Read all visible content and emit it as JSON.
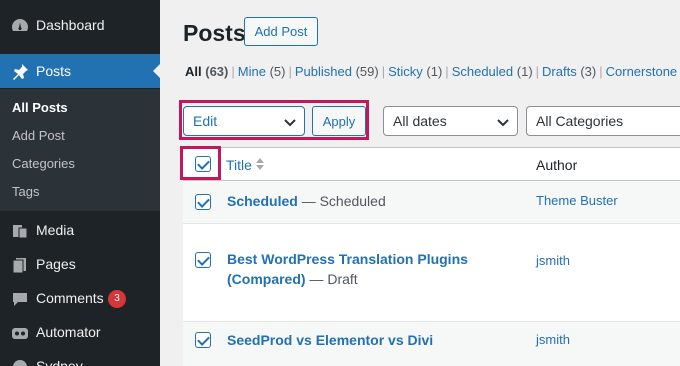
{
  "sidebar": {
    "items": [
      {
        "label": "Dashboard",
        "icon": "dashboard-icon"
      },
      {
        "label": "Posts",
        "icon": "pushpin-icon"
      },
      {
        "label": "Media",
        "icon": "media-icon"
      },
      {
        "label": "Pages",
        "icon": "pages-icon"
      },
      {
        "label": "Comments",
        "icon": "comments-icon",
        "badge": "3"
      },
      {
        "label": "Automator",
        "icon": "automator-icon"
      },
      {
        "label": "Sydney",
        "icon": "sydney-icon"
      }
    ],
    "submenu": [
      "All Posts",
      "Add Post",
      "Categories",
      "Tags"
    ]
  },
  "header": {
    "title": "Posts",
    "add_new": "Add Post"
  },
  "filters": [
    {
      "label": "All",
      "count": "(63)"
    },
    {
      "label": "Mine",
      "count": "(5)"
    },
    {
      "label": "Published",
      "count": "(59)"
    },
    {
      "label": "Sticky",
      "count": "(1)"
    },
    {
      "label": "Scheduled",
      "count": "(1)"
    },
    {
      "label": "Drafts",
      "count": "(3)"
    },
    {
      "label": "Cornerstone",
      "count": ""
    }
  ],
  "bulk": {
    "action": "Edit",
    "apply": "Apply",
    "dates": "All dates",
    "categories": "All Categories"
  },
  "table": {
    "headers": {
      "title": "Title",
      "author": "Author"
    },
    "rows": [
      {
        "title": "Scheduled",
        "state": "— Scheduled",
        "author": "Theme Buster"
      },
      {
        "title": "Best WordPress Translation Plugins (Compared)",
        "state": "— Draft",
        "author": "jsmith"
      },
      {
        "title": "SeedProd vs Elementor vs Divi",
        "state": "",
        "author": "jsmith"
      }
    ]
  },
  "colors": {
    "accent": "#2271b1",
    "sidebar": "#1d2327",
    "highlight": "#c2185b",
    "badge": "#d63638"
  }
}
